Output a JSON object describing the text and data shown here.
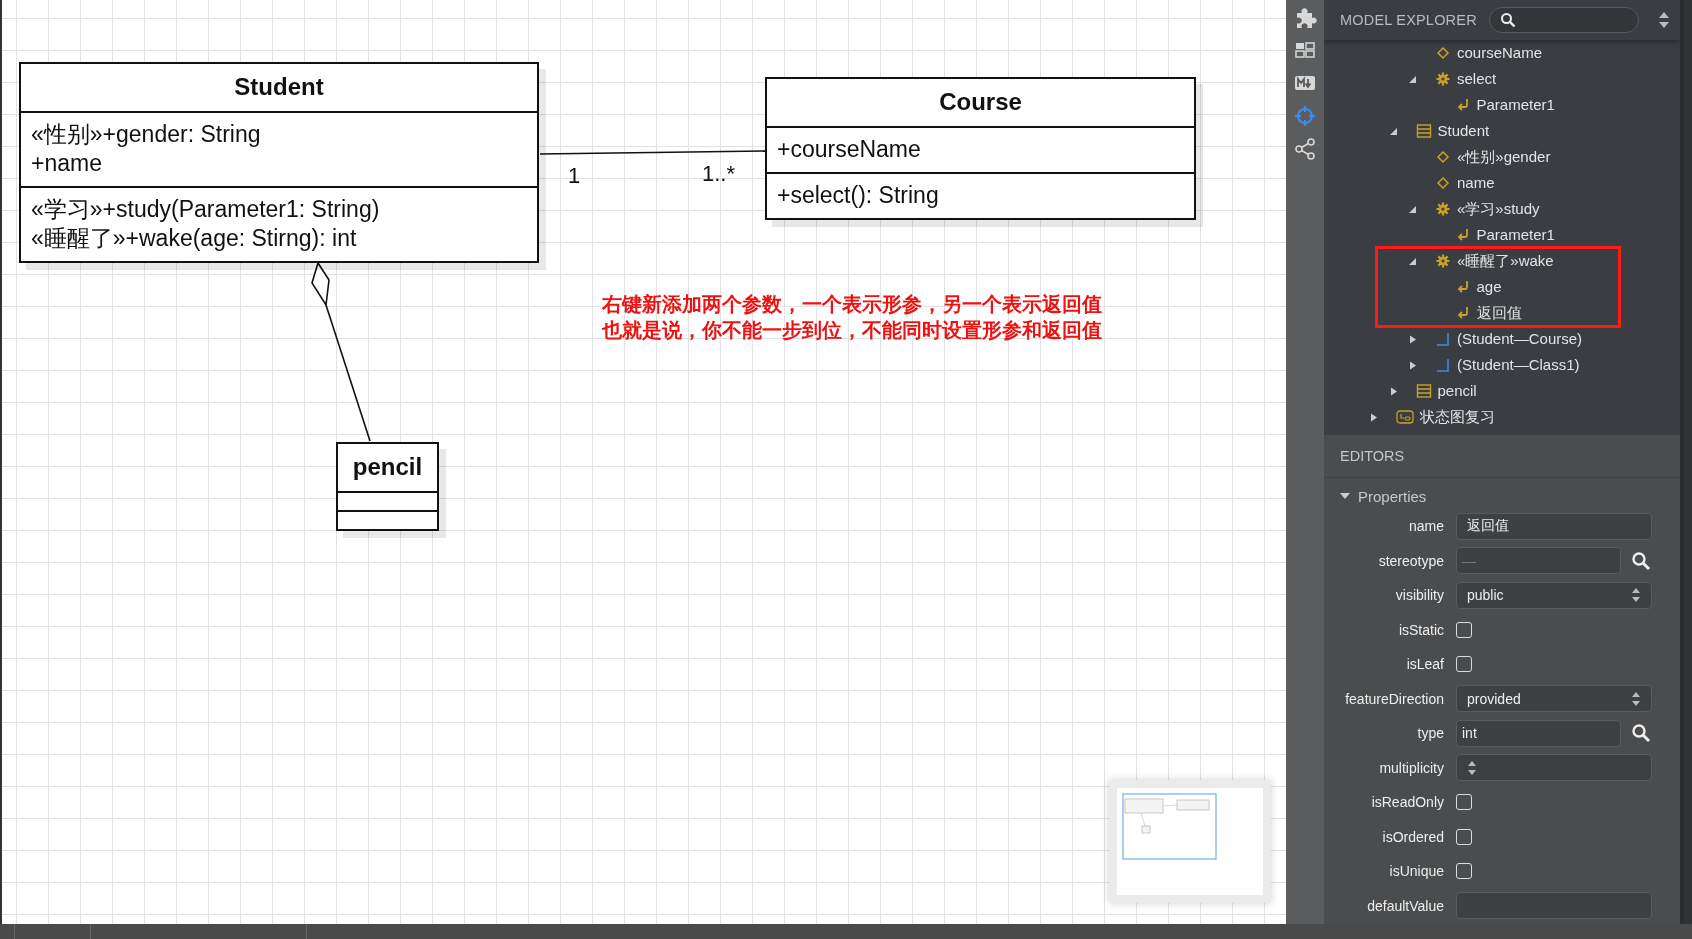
{
  "diagram": {
    "classes": [
      {
        "name": "Student",
        "attributes": [
          "«性别»+gender: String",
          "+name"
        ],
        "operations": [
          "«学习»+study(Parameter1: String)",
          "«睡醒了»+wake(age: Stirng): int"
        ]
      },
      {
        "name": "Course",
        "attributes": [
          "+courseName"
        ],
        "operations": [
          "+select(): String"
        ]
      },
      {
        "name": "pencil"
      }
    ],
    "association": {
      "source_multiplicity": "1",
      "target_multiplicity": "1..*"
    },
    "note_lines": [
      "右键新添加两个参数，一个表示形参，另一个表示返回值",
      "也就是说，你不能一步到位，不能同时设置形参和返回值"
    ]
  },
  "explorer": {
    "title": "MODEL EXPLORER",
    "tree": [
      {
        "children": [
          {
            "children": [
              {
                "label": "courseName",
                "kind": "attribute"
              },
              {
                "label": "select",
                "kind": "operation",
                "expanded": true,
                "children": [
                  {
                    "label": "Parameter1",
                    "kind": "parameter"
                  }
                ]
              }
            ]
          },
          {
            "label": "Student",
            "kind": "class",
            "expanded": true,
            "children": [
              {
                "label": "«性别»gender",
                "kind": "attribute"
              },
              {
                "label": "name",
                "kind": "attribute"
              },
              {
                "label": "«学习»study",
                "kind": "operation",
                "expanded": true,
                "children": [
                  {
                    "label": "Parameter1",
                    "kind": "parameter"
                  }
                ]
              },
              {
                "label": "«睡醒了»wake",
                "kind": "operation",
                "expanded": true,
                "annotated": true,
                "children": [
                  {
                    "label": "age",
                    "kind": "parameter"
                  },
                  {
                    "label": "返回值",
                    "kind": "parameter"
                  }
                ]
              },
              {
                "label": "(Student—Course)",
                "kind": "association",
                "expanded": false
              },
              {
                "label": "(Student—Class1)",
                "kind": "association",
                "expanded": false
              }
            ]
          },
          {
            "label": "pencil",
            "kind": "class",
            "expanded": false
          }
        ]
      },
      {
        "label": "状态图复习",
        "kind": "statechart",
        "expanded": false
      }
    ]
  },
  "editors": {
    "title": "EDITORS",
    "section": {
      "title": "Properties",
      "expanded": true
    },
    "properties": [
      {
        "kind": "text",
        "label": "name",
        "value": "返回值"
      },
      {
        "kind": "lookup",
        "label": "stereotype",
        "placeholder": "—"
      },
      {
        "kind": "select",
        "label": "visibility",
        "value": "public"
      },
      {
        "kind": "checkbox",
        "label": "isStatic",
        "checked": false
      },
      {
        "kind": "checkbox",
        "label": "isLeaf",
        "checked": false
      },
      {
        "kind": "select",
        "label": "featureDirection",
        "value": "provided"
      },
      {
        "kind": "lookup",
        "label": "type",
        "value": "int"
      },
      {
        "kind": "select",
        "label": "multiplicity"
      },
      {
        "kind": "checkbox",
        "label": "isReadOnly",
        "checked": false
      },
      {
        "kind": "checkbox",
        "label": "isOrdered",
        "checked": false
      },
      {
        "kind": "checkbox",
        "label": "isUnique",
        "checked": false
      },
      {
        "kind": "text",
        "label": "defaultValue"
      }
    ]
  }
}
